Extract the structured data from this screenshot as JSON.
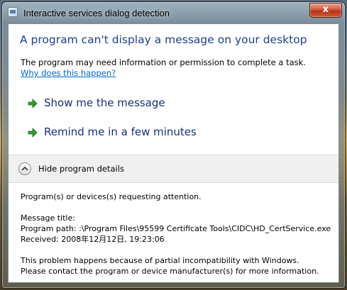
{
  "window": {
    "title": "Interactive services dialog detection",
    "close_glyph": "x"
  },
  "main": {
    "heading": "A program can't display a message on your desktop",
    "description": "The program may need information or permission to complete a task.",
    "why_link": "Why does this happen?"
  },
  "commands": [
    {
      "label": "Show me the message",
      "icon": "green-arrow-icon"
    },
    {
      "label": "Remind me in a few minutes",
      "icon": "green-arrow-icon"
    }
  ],
  "details_toggle": {
    "label": "Hide program details",
    "icon": "chevron-up-icon"
  },
  "details": {
    "requesting": "Program(s) or devices(s) requesting attention.",
    "message_title": "Message title:",
    "program_path": "Program path:  :\\Program Files\\95599 Certificate Tools\\CIDC\\HD_CertService.exe",
    "received": "Received:  2008年12月12日, 19:23:06",
    "problem_line1": "This problem happens because of partial incompatibility with Windows.",
    "problem_line2": "Please contact the program or device manufacturer(s) for more information."
  },
  "colors": {
    "heading": "#1d3f8a",
    "link": "#0066cc",
    "arrow": "#2e9b2e",
    "close_button": "#c8452a"
  }
}
